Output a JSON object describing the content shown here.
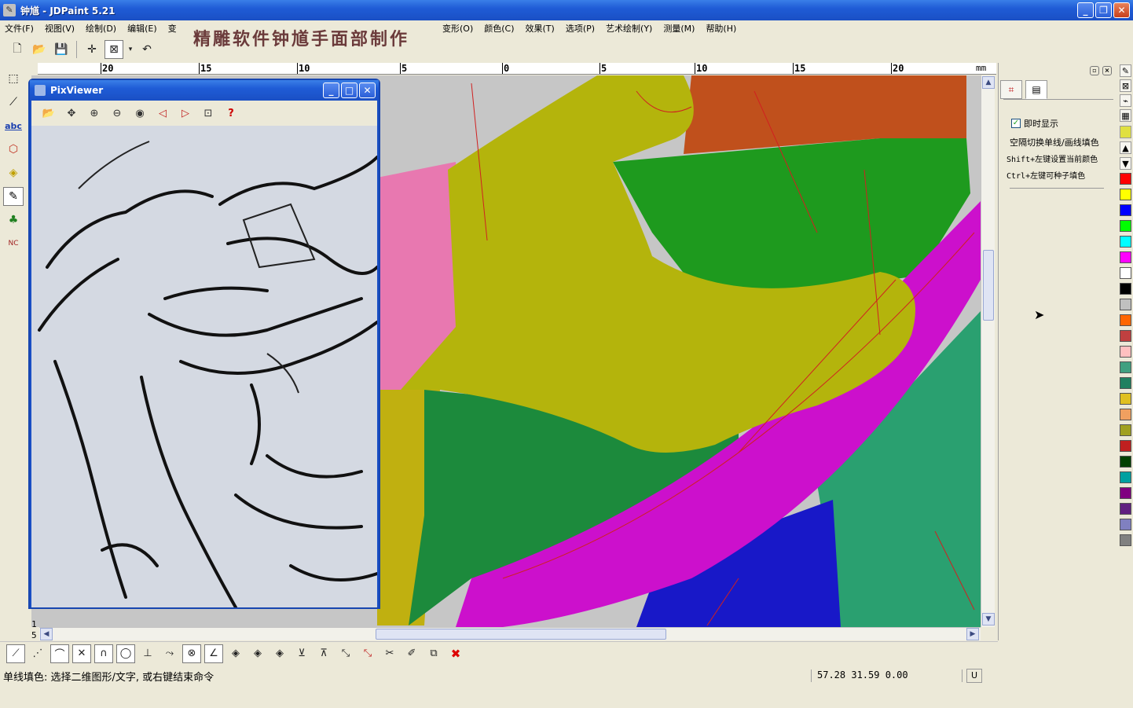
{
  "window": {
    "title": "钟馗 - JDPaint 5.21",
    "app_icon": "brush-icon"
  },
  "menu": {
    "left_items": [
      "文件(F)",
      "视图(V)",
      "绘制(D)",
      "编辑(E)",
      "变"
    ],
    "right_items": [
      "变形(O)",
      "颜色(C)",
      "效果(T)",
      "选项(P)",
      "艺术绘制(Y)",
      "测量(M)",
      "帮助(H)"
    ]
  },
  "overlay_caption": "精雕软件钟馗手面部制作",
  "toolbar": {
    "icons": [
      "new-file-icon",
      "open-folder-icon",
      "save-icon",
      "crosshair-icon",
      "select-box-icon",
      "undo-icon"
    ]
  },
  "ruler": {
    "labels": [
      "20",
      "15",
      "10",
      "5",
      "0",
      "5",
      "10",
      "15",
      "20"
    ],
    "unit": "mm"
  },
  "left_ruler": {
    "labels": [
      "1",
      "5"
    ]
  },
  "left_palette": {
    "icons": [
      "select-node-icon",
      "pen-node-icon",
      "text-abc-icon",
      "shape-icon",
      "fill-icon",
      "pencil-icon",
      "tree-icon",
      "nc-path-icon"
    ],
    "text_tool_label": "abc",
    "nc_label": "NC"
  },
  "pixviewer": {
    "title": "PixViewer",
    "tools": [
      "open-folder-icon",
      "move-icon",
      "zoom-in-icon",
      "zoom-out-icon",
      "eye-icon",
      "prev-icon",
      "next-icon",
      "zoom-fit-icon",
      "help-icon"
    ],
    "help_glyph": "?"
  },
  "right_panel": {
    "checkbox_label": "即时显示",
    "checkbox_checked": true,
    "help_lines": [
      "空隔切换单线/画线填色",
      "Shift+左键设置当前颜色",
      "Ctrl+左键可种子填色"
    ]
  },
  "colors": {
    "swatches": [
      "#ff0000",
      "#ffff00",
      "#0000ff",
      "#00ff00",
      "#00ffff",
      "#ff00ff",
      "#ffffff",
      "#000000",
      "#c0c0c0",
      "#ff6600",
      "#c04040",
      "#ffc0c0",
      "#40a080",
      "#208060",
      "#e0c020",
      "#f0a060",
      "#a0a020",
      "#c02020",
      "#004000",
      "#00a0a0",
      "#800080",
      "#602080",
      "#8080c0",
      "#808080"
    ]
  },
  "bottom_toolbar": {
    "icons": [
      "line-icon",
      "polyline-icon",
      "arc-icon",
      "cross-icon",
      "curve-icon",
      "circle-icon",
      "perpendicular-icon",
      "tangent-icon",
      "snap-icon",
      "angle-icon",
      "node-a-icon",
      "node-b-icon",
      "node-c-icon",
      "level-a-icon",
      "level-b-icon",
      "select-a-icon",
      "delete-select-icon",
      "cut-icon",
      "trim-icon",
      "copy-icon",
      "delete-icon"
    ]
  },
  "status": {
    "message": "单线填色: 选择二维图形/文字, 或右键结束命令",
    "coordinates": "57.28 31.59 0.00",
    "field": "U"
  }
}
